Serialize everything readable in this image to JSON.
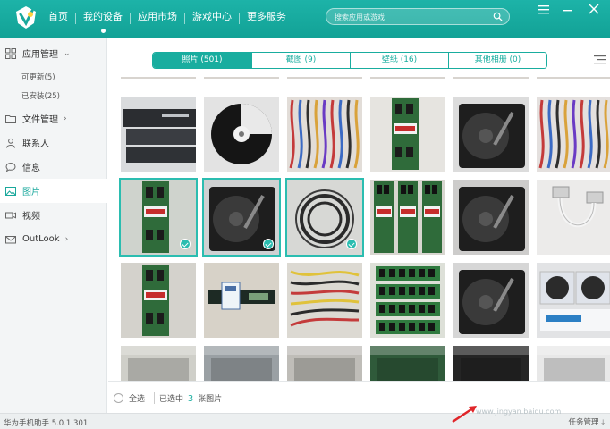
{
  "app": {
    "nav": [
      "首页",
      "我的设备",
      "应用市场",
      "游戏中心",
      "更多服务"
    ],
    "active_nav": 1,
    "search_placeholder": "搜索应用或游戏"
  },
  "sidebar": {
    "app_mgmt": "应用管理",
    "updatable": "可更新(5)",
    "installed": "已安装(25)",
    "file_mgmt": "文件管理",
    "contacts": "联系人",
    "messages": "信息",
    "photos": "图片",
    "videos": "视频",
    "outlook": "OutLook"
  },
  "tabs": [
    "照片 (501)",
    "截图 (9)",
    "壁纸 (16)",
    "其他相册 (0)"
  ],
  "active_tab": 0,
  "gallery": {
    "columns": 6,
    "photos": [
      {
        "kind": "partial-top",
        "bg": "#6a6d70"
      },
      {
        "kind": "partial-top",
        "bg": "#7b7d80"
      },
      {
        "kind": "partial-top",
        "bg": "#8d7f7a"
      },
      {
        "kind": "partial-top",
        "bg": "#5c6f5a"
      },
      {
        "kind": "partial-top",
        "bg": "#6e7175"
      },
      {
        "kind": "partial-top",
        "bg": "#8a7b7b"
      },
      {
        "kind": "switch-box",
        "bg": "#d9dbdd",
        "selected": false
      },
      {
        "kind": "cd-disc",
        "bg": "#e3e3e3",
        "selected": false
      },
      {
        "kind": "cables",
        "bg": "#e2ddd8",
        "selected": false
      },
      {
        "kind": "ram-module",
        "bg": "#e6e4e0",
        "selected": false
      },
      {
        "kind": "hard-drive",
        "bg": "#dcdcdc",
        "selected": false
      },
      {
        "kind": "cables",
        "bg": "#e4e0de",
        "selected": false
      },
      {
        "kind": "ram-module",
        "bg": "#cfd3cd",
        "selected": true
      },
      {
        "kind": "hard-drive",
        "bg": "#cfd1d2",
        "selected": true
      },
      {
        "kind": "cable-coil",
        "bg": "#d7d8d5",
        "selected": true
      },
      {
        "kind": "ram-set",
        "bg": "#d8d6d0",
        "selected": false
      },
      {
        "kind": "hard-drive",
        "bg": "#cdcccb",
        "selected": false
      },
      {
        "kind": "serial-cable",
        "bg": "#ecebea",
        "selected": false
      },
      {
        "kind": "ram-module",
        "bg": "#d4d2cc",
        "selected": false
      },
      {
        "kind": "circuit-board",
        "bg": "#d7d2c8",
        "selected": false
      },
      {
        "kind": "wire-bundle",
        "bg": "#dcd9d2",
        "selected": false
      },
      {
        "kind": "green-ram",
        "bg": "#dde0d8",
        "selected": false
      },
      {
        "kind": "hard-drive",
        "bg": "#d6d6d6",
        "selected": false
      },
      {
        "kind": "fan-box",
        "bg": "#e2e3e5",
        "selected": false
      },
      {
        "kind": "partial-bottom",
        "bg": "#cfcfc9",
        "selected": false
      },
      {
        "kind": "partial-bottom",
        "bg": "#9aa0a4",
        "selected": false
      },
      {
        "kind": "partial-bottom",
        "bg": "#bfbdb8",
        "selected": false
      },
      {
        "kind": "partial-bottom",
        "bg": "#2f5a3a",
        "selected": false
      },
      {
        "kind": "partial-bottom",
        "bg": "#252525",
        "selected": false
      },
      {
        "kind": "partial-bottom",
        "bg": "#e8e8e8",
        "selected": false
      }
    ]
  },
  "bottom": {
    "select_all": "全选",
    "selected_prefix": "已选中",
    "selected_count": "3",
    "selected_suffix": "张图片"
  },
  "status": {
    "version": "华为手机助手 5.0.1.301",
    "task_manager": "任务管理"
  },
  "watermark": "www.jingyan.baidu.com",
  "colors": {
    "accent": "#19ad9f",
    "topbar": "#15a89c"
  }
}
